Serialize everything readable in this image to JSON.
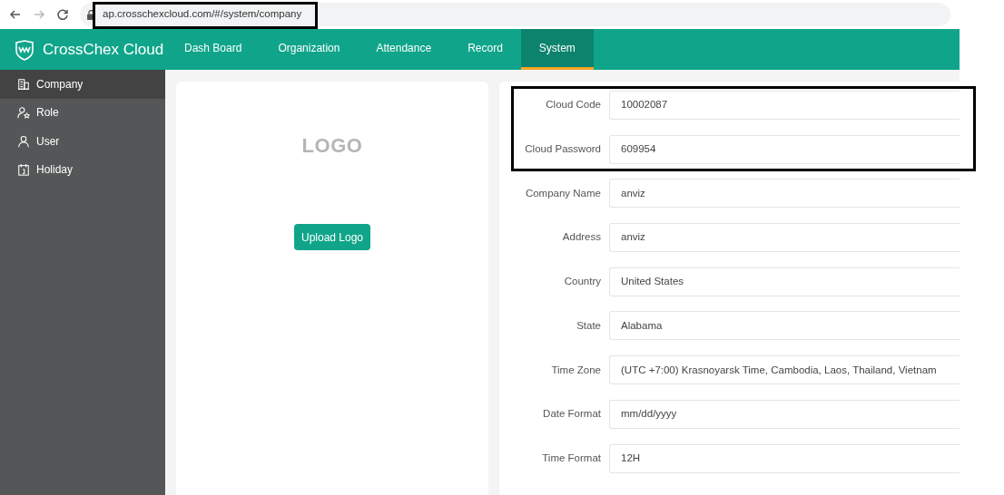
{
  "browser": {
    "url": "ap.crosschexcloud.com/#/system/company"
  },
  "app": {
    "title": "CrossChex Cloud"
  },
  "nav": [
    {
      "label": "Dash Board",
      "selected": false
    },
    {
      "label": "Organization",
      "selected": false
    },
    {
      "label": "Attendance",
      "selected": false
    },
    {
      "label": "Record",
      "selected": false
    },
    {
      "label": "System",
      "selected": true
    }
  ],
  "sidebar": {
    "items": [
      {
        "label": "Company",
        "kind": "building",
        "selected": true
      },
      {
        "label": "Role",
        "kind": "role",
        "selected": false
      },
      {
        "label": "User",
        "kind": "user",
        "selected": false
      },
      {
        "label": "Holiday",
        "kind": "calendar",
        "selected": false
      }
    ]
  },
  "logo_card": {
    "logo_label": "LOGO",
    "button": "Upload Logo"
  },
  "form": {
    "fields": [
      {
        "label": "Cloud Code",
        "value": "10002087"
      },
      {
        "label": "Cloud Password",
        "value": "609954"
      },
      {
        "label": "Company Name",
        "value": "anviz"
      },
      {
        "label": "Address",
        "value": "anviz"
      },
      {
        "label": "Country",
        "value": "United States"
      },
      {
        "label": "State",
        "value": "Alabama"
      },
      {
        "label": "Time Zone",
        "value": "(UTC +7:00) Krasnoyarsk Time, Cambodia, Laos, Thailand, Vietnam"
      },
      {
        "label": "Date Format",
        "value": "mm/dd/yyyy"
      },
      {
        "label": "Time Format",
        "value": "12H"
      }
    ]
  }
}
